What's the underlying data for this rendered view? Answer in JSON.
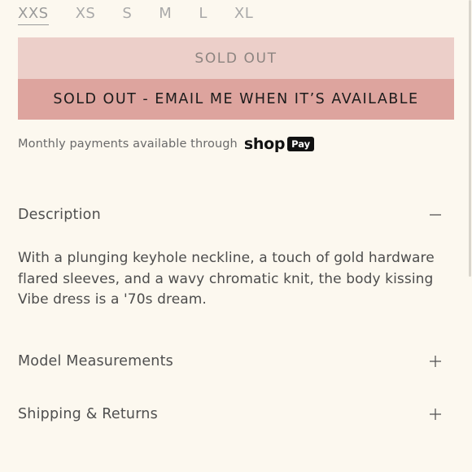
{
  "sizes": [
    {
      "label": "XXS",
      "selected": true
    },
    {
      "label": "XS",
      "selected": false
    },
    {
      "label": "S",
      "selected": false
    },
    {
      "label": "M",
      "selected": false
    },
    {
      "label": "L",
      "selected": false
    },
    {
      "label": "XL",
      "selected": false
    }
  ],
  "buttons": {
    "sold_out": "SOLD OUT",
    "notify": "SOLD OUT - EMAIL ME WHEN IT’S AVAILABLE"
  },
  "payments": {
    "text": "Monthly payments available through",
    "brand_word": "shop",
    "brand_pay": "Pay"
  },
  "accordion": {
    "description": {
      "title": "Description",
      "expanded": true,
      "icon": "minus-icon",
      "body": "With a plunging keyhole neckline, a touch of gold hardware flared sleeves, and a wavy chromatic knit, the body kissing Vibe dress is a '70s dream."
    },
    "model": {
      "title": "Model Measurements",
      "expanded": false,
      "icon": "plus-icon"
    },
    "shipping": {
      "title": "Shipping & Returns",
      "expanded": false,
      "icon": "plus-icon"
    }
  },
  "colors": {
    "background": "#fcf8ef",
    "sold_out_bg": "#eccfc9",
    "notify_bg": "#dda49e",
    "text": "#4a4a4a"
  }
}
